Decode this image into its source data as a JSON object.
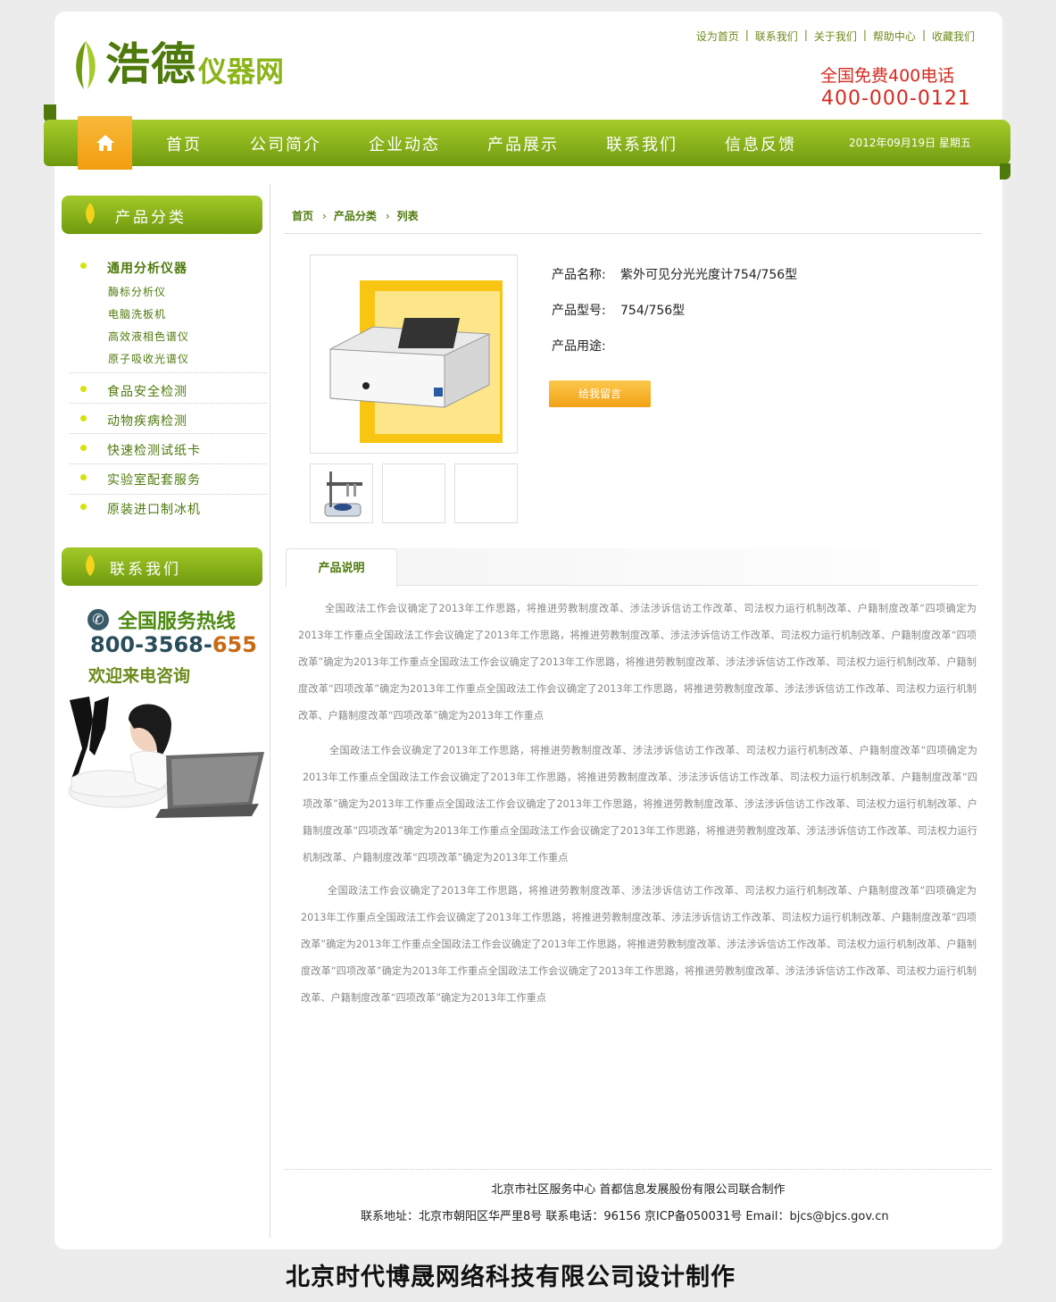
{
  "header": {
    "logo_main": "浩德",
    "logo_sub": "仪器网",
    "top_links": [
      "设为首页",
      "联系我们",
      "关于我们",
      "帮助中心",
      "收藏我们"
    ],
    "hotline_title": "全国免费400电话",
    "hotline_number": "400-000-0121"
  },
  "nav": {
    "items": [
      "首页",
      "公司简介",
      "企业动态",
      "产品展示",
      "联系我们",
      "信息反馈"
    ],
    "date": "2012年09月19日  星期五"
  },
  "sidebar": {
    "category_title": "产品分类",
    "categories": [
      {
        "label": "通用分析仪器",
        "sub": [
          "酶标分析仪",
          "电脑洗板机",
          "高效液相色谱仪",
          "原子吸收光谱仪"
        ]
      },
      {
        "label": "食品安全检测",
        "sub": []
      },
      {
        "label": "动物疾病检测",
        "sub": []
      },
      {
        "label": "快速检测试纸卡",
        "sub": []
      },
      {
        "label": "实验室配套服务",
        "sub": []
      },
      {
        "label": "原装进口制冰机",
        "sub": []
      }
    ],
    "contact_title": "联系我们",
    "service_title": "全国服务热线",
    "service_number_a": "800-3568-",
    "service_number_b": "655",
    "service_sub": "欢迎来电咨询"
  },
  "breadcrumb": [
    "首页",
    "产品分类",
    "列表"
  ],
  "product": {
    "name_label": "产品名称:",
    "name_value": "紫外可见分光光度计754/756型",
    "model_label": "产品型号:",
    "model_value": "754/756型",
    "usage_label": "产品用途:",
    "usage_value": "",
    "message_button": "给我留言"
  },
  "tab": {
    "label": "产品说明"
  },
  "description": [
    "全国政法工作会议确定了2013年工作思路，将推进劳教制度改革、涉法涉诉信访工作改革、司法权力运行机制改革、户籍制度改革“四项确定为2013年工作重点全国政法工作会议确定了2013年工作思路，将推进劳教制度改革、涉法涉诉信访工作改革、司法权力运行机制改革、户籍制度改革“四项改革”确定为2013年工作重点全国政法工作会议确定了2013年工作思路，将推进劳教制度改革、涉法涉诉信访工作改革、司法权力运行机制改革、户籍制度改革“四项改革”确定为2013年工作重点全国政法工作会议确定了2013年工作思路，将推进劳教制度改革、涉法涉诉信访工作改革、司法权力运行机制改革、户籍制度改革“四项改革”确定为2013年工作重点",
    "全国政法工作会议确定了2013年工作思路，将推进劳教制度改革、涉法涉诉信访工作改革、司法权力运行机制改革、户籍制度改革“四项确定为2013年工作重点全国政法工作会议确定了2013年工作思路，将推进劳教制度改革、涉法涉诉信访工作改革、司法权力运行机制改革、户籍制度改革“四项改革”确定为2013年工作重点全国政法工作会议确定了2013年工作思路，将推进劳教制度改革、涉法涉诉信访工作改革、司法权力运行机制改革、户籍制度改革“四项改革”确定为2013年工作重点全国政法工作会议确定了2013年工作思路，将推进劳教制度改革、涉法涉诉信访工作改革、司法权力运行机制改革、户籍制度改革“四项改革”确定为2013年工作重点",
    "全国政法工作会议确定了2013年工作思路，将推进劳教制度改革、涉法涉诉信访工作改革、司法权力运行机制改革、户籍制度改革“四项确定为2013年工作重点全国政法工作会议确定了2013年工作思路，将推进劳教制度改革、涉法涉诉信访工作改革、司法权力运行机制改革、户籍制度改革“四项改革”确定为2013年工作重点全国政法工作会议确定了2013年工作思路，将推进劳教制度改革、涉法涉诉信访工作改革、司法权力运行机制改革、户籍制度改革“四项改革”确定为2013年工作重点全国政法工作会议确定了2013年工作思路，将推进劳教制度改革、涉法涉诉信访工作改革、司法权力运行机制改革、户籍制度改革“四项改革”确定为2013年工作重点"
  ],
  "footer": {
    "line1": "北京市社区服务中心 首都信息发展股份有限公司联合制作",
    "line2": "联系地址：北京市朝阳区华严里8号 联系电话：96156 京ICP备050031号 Email：bjcs@bjcs.gov.cn"
  },
  "credit": "北京时代博晟网络科技有限公司设计制作",
  "colors": {
    "brand_green": "#6f9a0e",
    "accent_orange": "#f3a115",
    "hotline_red": "#d62a1f"
  }
}
